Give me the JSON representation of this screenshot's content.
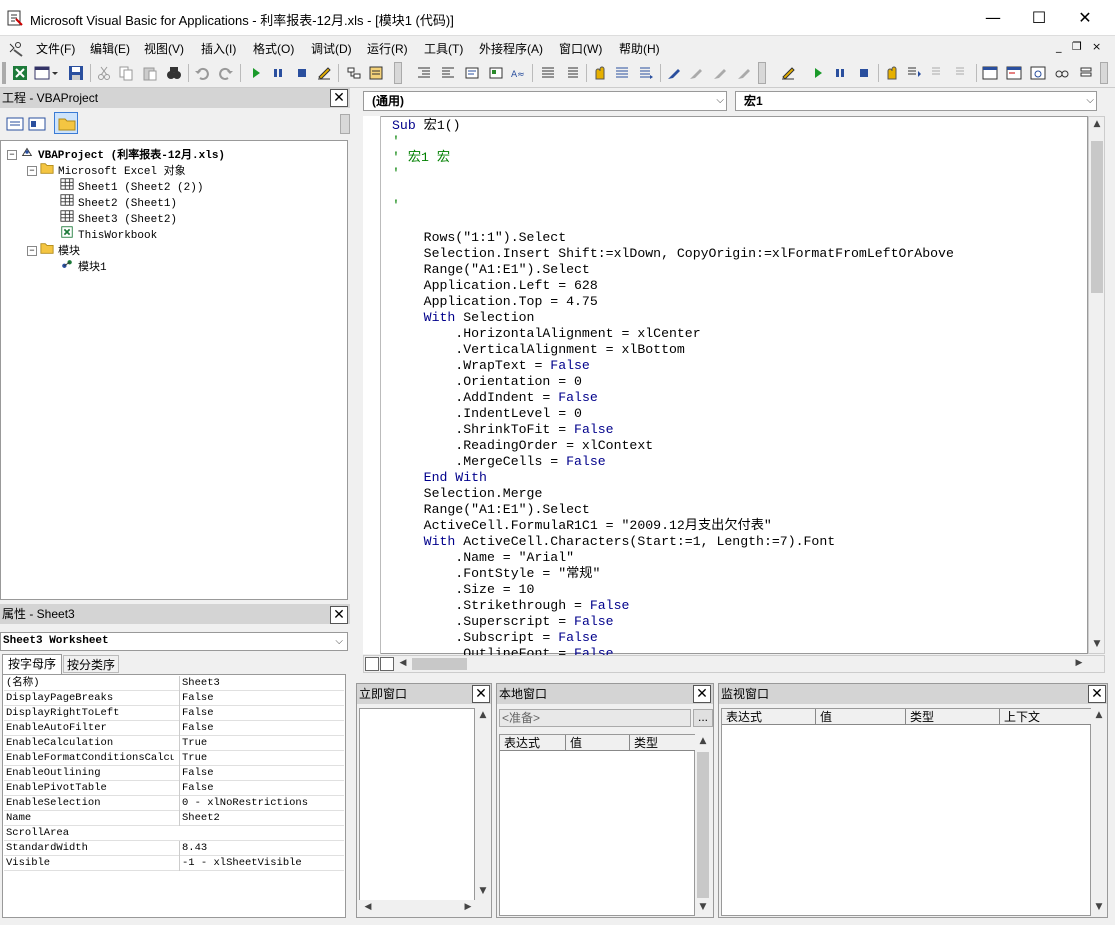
{
  "window": {
    "title": "Microsoft Visual Basic for Applications - 利率报表-12月.xls - [模块1 (代码)]",
    "minimize": "—",
    "maximize": "☐",
    "close": "✕"
  },
  "menu": {
    "items": [
      "文件(F)",
      "编辑(E)",
      "视图(V)",
      "插入(I)",
      "格式(O)",
      "调试(D)",
      "运行(R)",
      "工具(T)",
      "外接程序(A)",
      "窗口(W)",
      "帮助(H)"
    ],
    "mdi_min": "_",
    "mdi_restore": "❐",
    "mdi_close": "×"
  },
  "project": {
    "title": "工程 - VBAProject",
    "tree": [
      {
        "label": "VBAProject (利率报表-12月.xls)",
        "icon": "vba-project-icon",
        "level": 0,
        "bold": true,
        "expander": "−"
      },
      {
        "label": "Microsoft Excel 对象",
        "icon": "folder-icon",
        "level": 1,
        "bold": false,
        "expander": "−"
      },
      {
        "label": "Sheet1 (Sheet2 (2))",
        "icon": "worksheet-icon",
        "level": 2,
        "bold": false,
        "expander": ""
      },
      {
        "label": "Sheet2 (Sheet1)",
        "icon": "worksheet-icon",
        "level": 2,
        "bold": false,
        "expander": ""
      },
      {
        "label": "Sheet3 (Sheet2)",
        "icon": "worksheet-icon",
        "level": 2,
        "bold": false,
        "expander": ""
      },
      {
        "label": "ThisWorkbook",
        "icon": "workbook-icon",
        "level": 2,
        "bold": false,
        "expander": ""
      },
      {
        "label": "模块",
        "icon": "folder-icon",
        "level": 1,
        "bold": false,
        "expander": "−"
      },
      {
        "label": "模块1",
        "icon": "module-icon",
        "level": 2,
        "bold": false,
        "expander": ""
      }
    ]
  },
  "properties": {
    "title": "属性 - Sheet3",
    "object_combo": "Sheet3 Worksheet",
    "tabs": [
      "按字母序",
      "按分类序"
    ],
    "rows": [
      {
        "name": "(名称)",
        "value": "Sheet3"
      },
      {
        "name": "DisplayPageBreaks",
        "value": "False"
      },
      {
        "name": "DisplayRightToLeft",
        "value": "False"
      },
      {
        "name": "EnableAutoFilter",
        "value": "False"
      },
      {
        "name": "EnableCalculation",
        "value": "True"
      },
      {
        "name": "EnableFormatConditionsCalcul:",
        "value": "True"
      },
      {
        "name": "EnableOutlining",
        "value": "False"
      },
      {
        "name": "EnablePivotTable",
        "value": "False"
      },
      {
        "name": "EnableSelection",
        "value": "0 - xlNoRestrictions"
      },
      {
        "name": "Name",
        "value": "Sheet2"
      },
      {
        "name": "ScrollArea",
        "value": ""
      },
      {
        "name": "StandardWidth",
        "value": "8.43"
      },
      {
        "name": "Visible",
        "value": "-1 - xlSheetVisible"
      }
    ]
  },
  "code": {
    "object_combo": "(通用)",
    "proc_combo": "宏1",
    "lines": [
      [
        [
          "kw",
          "Sub"
        ],
        [
          "t",
          " 宏1()"
        ]
      ],
      [
        [
          "cm",
          "'"
        ]
      ],
      [
        [
          "cm",
          "' 宏1 宏"
        ]
      ],
      [
        [
          "cm",
          "'"
        ]
      ],
      [
        [
          "t",
          ""
        ]
      ],
      [
        [
          "cm",
          "'"
        ]
      ],
      [
        [
          "t",
          ""
        ]
      ],
      [
        [
          "t",
          "    Rows(\"1:1\").Select"
        ]
      ],
      [
        [
          "t",
          "    Selection.Insert Shift:=xlDown, CopyOrigin:=xlFormatFromLeftOrAbove"
        ]
      ],
      [
        [
          "t",
          "    Range(\"A1:E1\").Select"
        ]
      ],
      [
        [
          "t",
          "    Application.Left = 628"
        ]
      ],
      [
        [
          "t",
          "    Application.Top = 4.75"
        ]
      ],
      [
        [
          "t",
          "    "
        ],
        [
          "kw",
          "With"
        ],
        [
          "t",
          " Selection"
        ]
      ],
      [
        [
          "t",
          "        .HorizontalAlignment = xlCenter"
        ]
      ],
      [
        [
          "t",
          "        .VerticalAlignment = xlBottom"
        ]
      ],
      [
        [
          "t",
          "        .WrapText = "
        ],
        [
          "kw",
          "False"
        ]
      ],
      [
        [
          "t",
          "        .Orientation = 0"
        ]
      ],
      [
        [
          "t",
          "        .AddIndent = "
        ],
        [
          "kw",
          "False"
        ]
      ],
      [
        [
          "t",
          "        .IndentLevel = 0"
        ]
      ],
      [
        [
          "t",
          "        .ShrinkToFit = "
        ],
        [
          "kw",
          "False"
        ]
      ],
      [
        [
          "t",
          "        .ReadingOrder = xlContext"
        ]
      ],
      [
        [
          "t",
          "        .MergeCells = "
        ],
        [
          "kw",
          "False"
        ]
      ],
      [
        [
          "t",
          "    "
        ],
        [
          "kw",
          "End With"
        ]
      ],
      [
        [
          "t",
          "    Selection.Merge"
        ]
      ],
      [
        [
          "t",
          "    Range(\"A1:E1\").Select"
        ]
      ],
      [
        [
          "t",
          "    ActiveCell.FormulaR1C1 = \"2009.12月支出欠付表\""
        ]
      ],
      [
        [
          "t",
          "    "
        ],
        [
          "kw",
          "With"
        ],
        [
          "t",
          " ActiveCell.Characters(Start:=1, Length:=7).Font"
        ]
      ],
      [
        [
          "t",
          "        .Name = \"Arial\""
        ]
      ],
      [
        [
          "t",
          "        .FontStyle = \"常规\""
        ]
      ],
      [
        [
          "t",
          "        .Size = 10"
        ]
      ],
      [
        [
          "t",
          "        .Strikethrough = "
        ],
        [
          "kw",
          "False"
        ]
      ],
      [
        [
          "t",
          "        .Superscript = "
        ],
        [
          "kw",
          "False"
        ]
      ],
      [
        [
          "t",
          "        .Subscript = "
        ],
        [
          "kw",
          "False"
        ]
      ],
      [
        [
          "t",
          "        .OutlineFont = "
        ],
        [
          "kw",
          "False"
        ]
      ]
    ]
  },
  "immediate": {
    "title": "立即窗口"
  },
  "locals": {
    "title": "本地窗口",
    "status": "<准备>",
    "button": "...",
    "columns": [
      "表达式",
      "值",
      "类型"
    ]
  },
  "watch": {
    "title": "监视窗口",
    "columns": [
      "表达式",
      "值",
      "类型",
      "上下文"
    ]
  },
  "colors": {
    "keyword": "#00008b",
    "comment": "#008000",
    "pane_header": "#d4d4d4"
  }
}
